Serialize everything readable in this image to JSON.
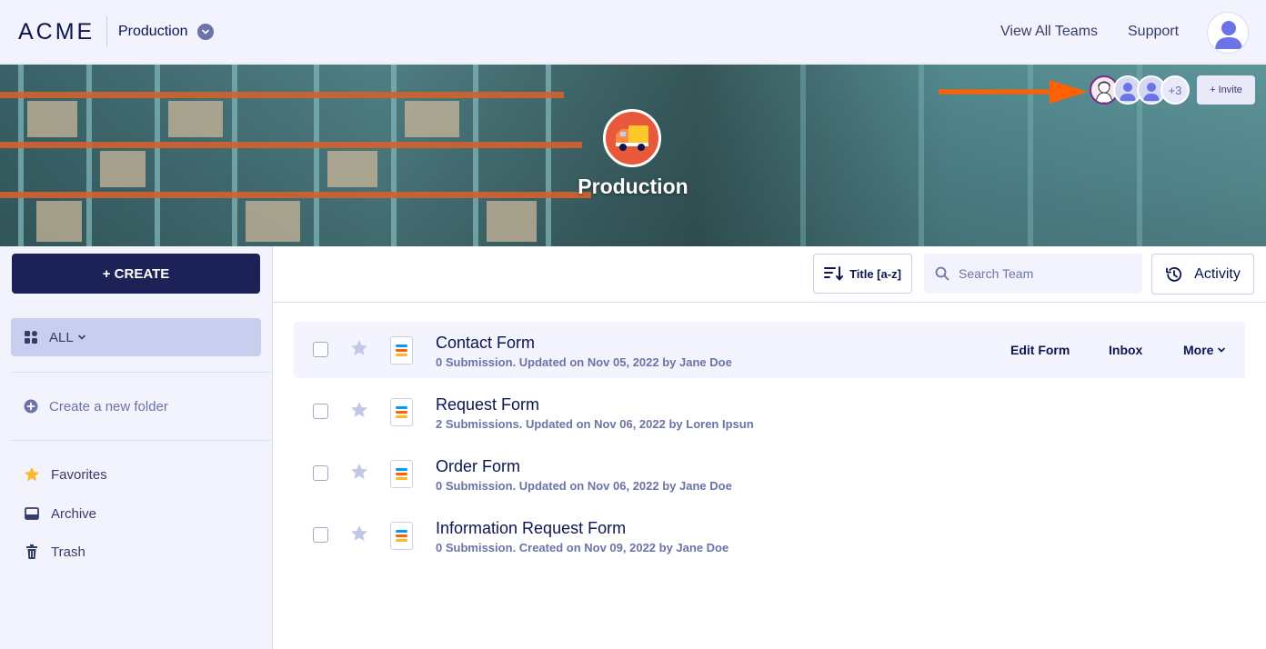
{
  "header": {
    "logo": "ACME",
    "team_name": "Production",
    "nav": {
      "view_all_teams": "View All Teams",
      "support": "Support"
    }
  },
  "banner": {
    "team_title": "Production",
    "members_more": "+3",
    "invite_label": "+ Invite"
  },
  "sidebar": {
    "create_label": "+ CREATE",
    "filter_label": "ALL",
    "new_folder_label": "Create a new folder",
    "items": [
      {
        "label": "Favorites",
        "icon": "star-icon"
      },
      {
        "label": "Archive",
        "icon": "archive-icon"
      },
      {
        "label": "Trash",
        "icon": "trash-icon"
      }
    ]
  },
  "toolbar": {
    "sort_label": "Title [a-z]",
    "search_placeholder": "Search Team",
    "activity_label": "Activity"
  },
  "forms": [
    {
      "title": "Contact Form",
      "meta": "0 Submission. Updated on Nov 05, 2022 by Jane Doe"
    },
    {
      "title": "Request Form",
      "meta": "2 Submissions. Updated on Nov 06, 2022 by Loren Ipsun"
    },
    {
      "title": "Order Form",
      "meta": "0 Submission. Updated on Nov 06, 2022 by Jane Doe"
    },
    {
      "title": "Information Request Form",
      "meta": "0 Submission. Created on Nov 09, 2022 by Jane Doe"
    }
  ],
  "row_actions": {
    "edit": "Edit Form",
    "inbox": "Inbox",
    "more": "More"
  },
  "colors": {
    "primary_navy": "#0a1551",
    "create_button": "#1c2156",
    "accent_orange": "#ff6100",
    "sidebar_bg": "#f3f3fe",
    "favorite_star": "#ffb629"
  }
}
